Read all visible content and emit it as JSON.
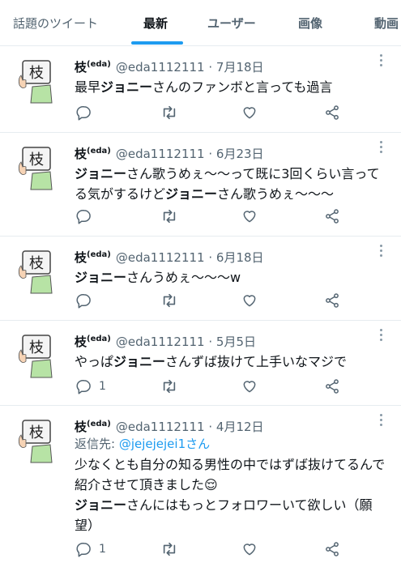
{
  "tabs": [
    {
      "label": "話題のツイート"
    },
    {
      "label": "最新"
    },
    {
      "label": "ユーザー"
    },
    {
      "label": "画像"
    },
    {
      "label": "動画"
    }
  ],
  "avatar_char": "枝",
  "tweets": [
    {
      "name": "枝",
      "name_sup": "(eda)",
      "handle_date": "@eda1112111 · 7月18日",
      "reply_to_prefix": "",
      "reply_to_handle": "",
      "text_parts": [
        "最早",
        "ジョニー",
        "さんのファンボと言っても過言"
      ],
      "text_parts_2": [
        "",
        "",
        ""
      ],
      "reply_count": "",
      "retweet_count": "",
      "like_count": ""
    },
    {
      "name": "枝",
      "name_sup": "(eda)",
      "handle_date": "@eda1112111 · 6月23日",
      "reply_to_prefix": "",
      "reply_to_handle": "",
      "text_parts": [
        "",
        "ジョニー",
        "さん歌うめぇ〜〜って既に3回くらい言ってる気がするけど",
        "ジョニー",
        "さん歌うめぇ〜〜〜"
      ],
      "reply_count": "",
      "retweet_count": "",
      "like_count": ""
    },
    {
      "name": "枝",
      "name_sup": "(eda)",
      "handle_date": "@eda1112111 · 6月18日",
      "reply_to_prefix": "",
      "reply_to_handle": "",
      "text_parts": [
        "",
        "ジョニー",
        "さんうめぇ〜〜〜w"
      ],
      "reply_count": "",
      "retweet_count": "",
      "like_count": ""
    },
    {
      "name": "枝",
      "name_sup": "(eda)",
      "handle_date": "@eda1112111 · 5月5日",
      "reply_to_prefix": "",
      "reply_to_handle": "",
      "text_parts": [
        "やっぱ",
        "ジョニー",
        "さんずば抜けて上手いなマジで"
      ],
      "reply_count": "1",
      "retweet_count": "",
      "like_count": ""
    },
    {
      "name": "枝",
      "name_sup": "(eda)",
      "handle_date": "@eda1112111 · 4月12日",
      "reply_to_prefix": "返信先: ",
      "reply_to_handle": "@jejejejei1さん",
      "text_line1": "少なくとも自分の知る男性の中ではずば抜けてるんで紹介させて頂きました😌",
      "text_parts": [
        "",
        "ジョニー",
        "さんにはもっとフォロワーいて欲しい（願望）"
      ],
      "reply_count": "1",
      "retweet_count": "",
      "like_count": ""
    }
  ]
}
